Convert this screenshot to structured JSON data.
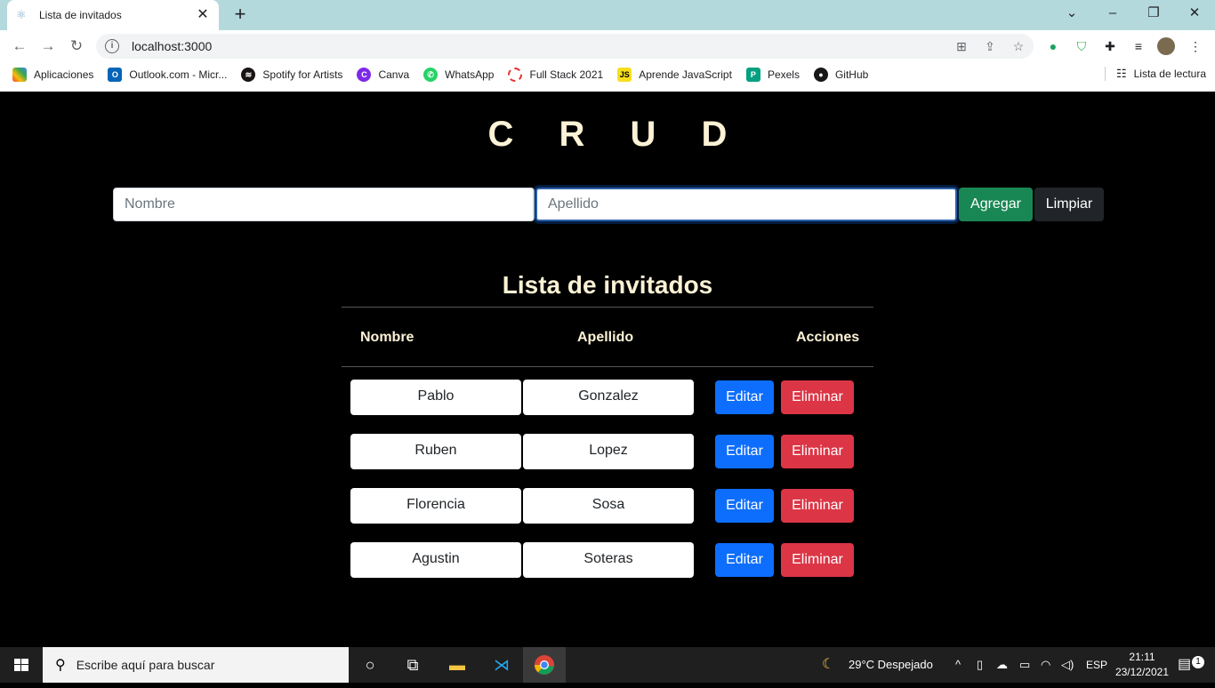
{
  "browser": {
    "tab_title": "Lista de invitados",
    "url": "localhost:3000",
    "bookmarks": [
      "Aplicaciones",
      "Outlook.com - Micr...",
      "Spotify for Artists",
      "Canva",
      "WhatsApp",
      "Full Stack 2021",
      "Aprende JavaScript",
      "Pexels",
      "GitHub"
    ],
    "reading_list": "Lista de lectura"
  },
  "app": {
    "title": "C R U D",
    "form": {
      "nombre_placeholder": "Nombre",
      "apellido_placeholder": "Apellido",
      "add_label": "Agregar",
      "clear_label": "Limpiar"
    },
    "list_title": "Lista de invitados",
    "headers": {
      "nombre": "Nombre",
      "apellido": "Apellido",
      "acciones": "Acciones"
    },
    "guests": [
      {
        "nombre": "Pablo",
        "apellido": "Gonzalez"
      },
      {
        "nombre": "Ruben",
        "apellido": "Lopez"
      },
      {
        "nombre": "Florencia",
        "apellido": "Sosa"
      },
      {
        "nombre": "Agustin",
        "apellido": "Soteras"
      }
    ],
    "edit_label": "Editar",
    "delete_label": "Eliminar"
  },
  "taskbar": {
    "search_placeholder": "Escribe aquí para buscar",
    "weather": "29°C  Despejado",
    "lang": "ESP",
    "time": "21:11",
    "date": "23/12/2021",
    "notifications": "1"
  },
  "colors": {
    "success": "#198754",
    "primary": "#0d6efd",
    "danger": "#dc3545",
    "dark": "#212529"
  }
}
